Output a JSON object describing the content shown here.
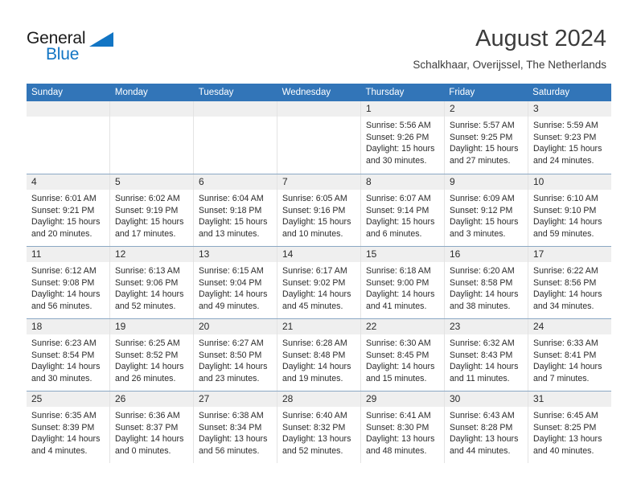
{
  "brand": {
    "name_part1": "General",
    "name_part2": "Blue",
    "triangle_color": "#1275c4",
    "accent_color": "#1275c4"
  },
  "header": {
    "title": "August 2024",
    "subtitle": "Schalkhaar, Overijssel, The Netherlands",
    "header_bg_color": "#3275b8",
    "day_band_color": "#efefef"
  },
  "weekdays": [
    "Sunday",
    "Monday",
    "Tuesday",
    "Wednesday",
    "Thursday",
    "Friday",
    "Saturday"
  ],
  "labels": {
    "sunrise_prefix": "Sunrise:",
    "sunset_prefix": "Sunset:",
    "daylight_prefix": "Daylight:"
  },
  "weeks": [
    [
      {
        "day": "",
        "sunrise": "",
        "sunset": "",
        "daylight": ""
      },
      {
        "day": "",
        "sunrise": "",
        "sunset": "",
        "daylight": ""
      },
      {
        "day": "",
        "sunrise": "",
        "sunset": "",
        "daylight": ""
      },
      {
        "day": "",
        "sunrise": "",
        "sunset": "",
        "daylight": ""
      },
      {
        "day": "1",
        "sunrise": "Sunrise: 5:56 AM",
        "sunset": "Sunset: 9:26 PM",
        "daylight": "Daylight: 15 hours and 30 minutes."
      },
      {
        "day": "2",
        "sunrise": "Sunrise: 5:57 AM",
        "sunset": "Sunset: 9:25 PM",
        "daylight": "Daylight: 15 hours and 27 minutes."
      },
      {
        "day": "3",
        "sunrise": "Sunrise: 5:59 AM",
        "sunset": "Sunset: 9:23 PM",
        "daylight": "Daylight: 15 hours and 24 minutes."
      }
    ],
    [
      {
        "day": "4",
        "sunrise": "Sunrise: 6:01 AM",
        "sunset": "Sunset: 9:21 PM",
        "daylight": "Daylight: 15 hours and 20 minutes."
      },
      {
        "day": "5",
        "sunrise": "Sunrise: 6:02 AM",
        "sunset": "Sunset: 9:19 PM",
        "daylight": "Daylight: 15 hours and 17 minutes."
      },
      {
        "day": "6",
        "sunrise": "Sunrise: 6:04 AM",
        "sunset": "Sunset: 9:18 PM",
        "daylight": "Daylight: 15 hours and 13 minutes."
      },
      {
        "day": "7",
        "sunrise": "Sunrise: 6:05 AM",
        "sunset": "Sunset: 9:16 PM",
        "daylight": "Daylight: 15 hours and 10 minutes."
      },
      {
        "day": "8",
        "sunrise": "Sunrise: 6:07 AM",
        "sunset": "Sunset: 9:14 PM",
        "daylight": "Daylight: 15 hours and 6 minutes."
      },
      {
        "day": "9",
        "sunrise": "Sunrise: 6:09 AM",
        "sunset": "Sunset: 9:12 PM",
        "daylight": "Daylight: 15 hours and 3 minutes."
      },
      {
        "day": "10",
        "sunrise": "Sunrise: 6:10 AM",
        "sunset": "Sunset: 9:10 PM",
        "daylight": "Daylight: 14 hours and 59 minutes."
      }
    ],
    [
      {
        "day": "11",
        "sunrise": "Sunrise: 6:12 AM",
        "sunset": "Sunset: 9:08 PM",
        "daylight": "Daylight: 14 hours and 56 minutes."
      },
      {
        "day": "12",
        "sunrise": "Sunrise: 6:13 AM",
        "sunset": "Sunset: 9:06 PM",
        "daylight": "Daylight: 14 hours and 52 minutes."
      },
      {
        "day": "13",
        "sunrise": "Sunrise: 6:15 AM",
        "sunset": "Sunset: 9:04 PM",
        "daylight": "Daylight: 14 hours and 49 minutes."
      },
      {
        "day": "14",
        "sunrise": "Sunrise: 6:17 AM",
        "sunset": "Sunset: 9:02 PM",
        "daylight": "Daylight: 14 hours and 45 minutes."
      },
      {
        "day": "15",
        "sunrise": "Sunrise: 6:18 AM",
        "sunset": "Sunset: 9:00 PM",
        "daylight": "Daylight: 14 hours and 41 minutes."
      },
      {
        "day": "16",
        "sunrise": "Sunrise: 6:20 AM",
        "sunset": "Sunset: 8:58 PM",
        "daylight": "Daylight: 14 hours and 38 minutes."
      },
      {
        "day": "17",
        "sunrise": "Sunrise: 6:22 AM",
        "sunset": "Sunset: 8:56 PM",
        "daylight": "Daylight: 14 hours and 34 minutes."
      }
    ],
    [
      {
        "day": "18",
        "sunrise": "Sunrise: 6:23 AM",
        "sunset": "Sunset: 8:54 PM",
        "daylight": "Daylight: 14 hours and 30 minutes."
      },
      {
        "day": "19",
        "sunrise": "Sunrise: 6:25 AM",
        "sunset": "Sunset: 8:52 PM",
        "daylight": "Daylight: 14 hours and 26 minutes."
      },
      {
        "day": "20",
        "sunrise": "Sunrise: 6:27 AM",
        "sunset": "Sunset: 8:50 PM",
        "daylight": "Daylight: 14 hours and 23 minutes."
      },
      {
        "day": "21",
        "sunrise": "Sunrise: 6:28 AM",
        "sunset": "Sunset: 8:48 PM",
        "daylight": "Daylight: 14 hours and 19 minutes."
      },
      {
        "day": "22",
        "sunrise": "Sunrise: 6:30 AM",
        "sunset": "Sunset: 8:45 PM",
        "daylight": "Daylight: 14 hours and 15 minutes."
      },
      {
        "day": "23",
        "sunrise": "Sunrise: 6:32 AM",
        "sunset": "Sunset: 8:43 PM",
        "daylight": "Daylight: 14 hours and 11 minutes."
      },
      {
        "day": "24",
        "sunrise": "Sunrise: 6:33 AM",
        "sunset": "Sunset: 8:41 PM",
        "daylight": "Daylight: 14 hours and 7 minutes."
      }
    ],
    [
      {
        "day": "25",
        "sunrise": "Sunrise: 6:35 AM",
        "sunset": "Sunset: 8:39 PM",
        "daylight": "Daylight: 14 hours and 4 minutes."
      },
      {
        "day": "26",
        "sunrise": "Sunrise: 6:36 AM",
        "sunset": "Sunset: 8:37 PM",
        "daylight": "Daylight: 14 hours and 0 minutes."
      },
      {
        "day": "27",
        "sunrise": "Sunrise: 6:38 AM",
        "sunset": "Sunset: 8:34 PM",
        "daylight": "Daylight: 13 hours and 56 minutes."
      },
      {
        "day": "28",
        "sunrise": "Sunrise: 6:40 AM",
        "sunset": "Sunset: 8:32 PM",
        "daylight": "Daylight: 13 hours and 52 minutes."
      },
      {
        "day": "29",
        "sunrise": "Sunrise: 6:41 AM",
        "sunset": "Sunset: 8:30 PM",
        "daylight": "Daylight: 13 hours and 48 minutes."
      },
      {
        "day": "30",
        "sunrise": "Sunrise: 6:43 AM",
        "sunset": "Sunset: 8:28 PM",
        "daylight": "Daylight: 13 hours and 44 minutes."
      },
      {
        "day": "31",
        "sunrise": "Sunrise: 6:45 AM",
        "sunset": "Sunset: 8:25 PM",
        "daylight": "Daylight: 13 hours and 40 minutes."
      }
    ]
  ]
}
